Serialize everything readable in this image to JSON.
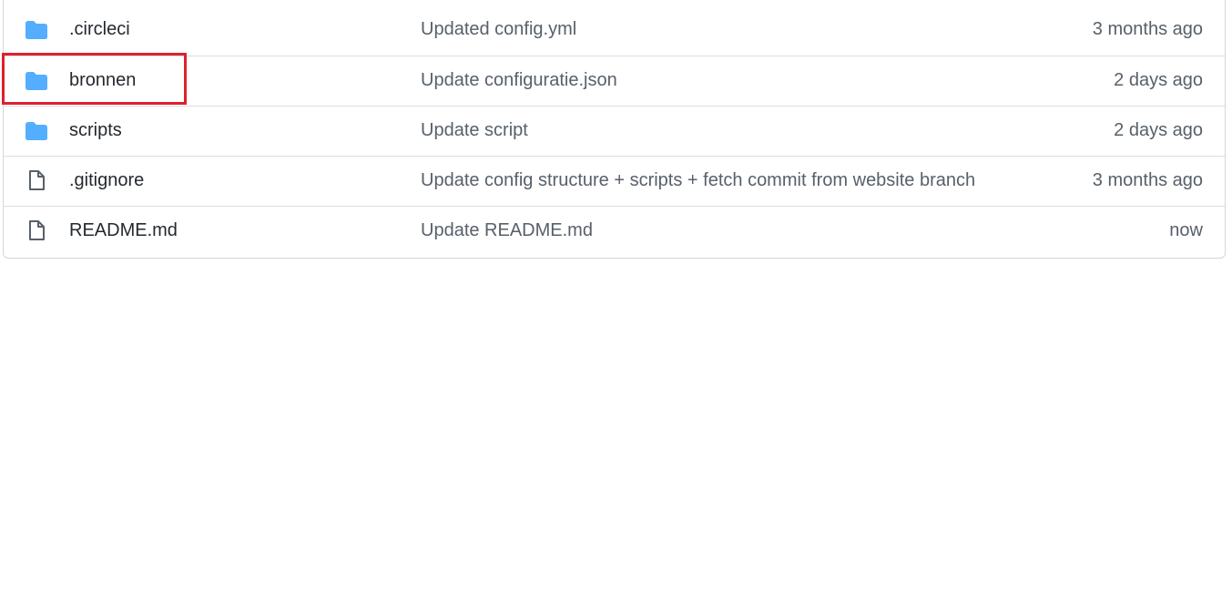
{
  "files": [
    {
      "type": "folder",
      "icon": "folder-icon",
      "name": ".circleci",
      "message": "Updated config.yml",
      "age": "3 months ago"
    },
    {
      "type": "folder",
      "icon": "folder-icon",
      "name": "bronnen",
      "message": "Update configuratie.json",
      "age": "2 days ago"
    },
    {
      "type": "folder",
      "icon": "folder-icon",
      "name": "scripts",
      "message": "Update script",
      "age": "2 days ago"
    },
    {
      "type": "file",
      "icon": "file-icon",
      "name": ".gitignore",
      "message": "Update config structure + scripts + fetch commit from website branch",
      "age": "3 months ago"
    },
    {
      "type": "file",
      "icon": "file-icon",
      "name": "README.md",
      "message": "Update README.md",
      "age": "now"
    }
  ],
  "colors": {
    "folder": "#54aeff",
    "file_icon": "#57606a",
    "highlight": "#e0202c",
    "border": "#d0d7de"
  }
}
